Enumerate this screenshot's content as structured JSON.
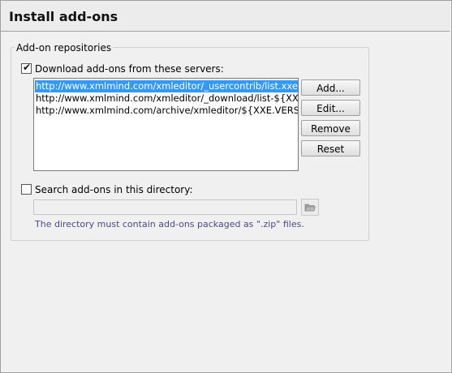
{
  "header": {
    "title": "Install add-ons"
  },
  "repositories": {
    "group_title": "Add-on repositories",
    "download_checkbox": {
      "label": "Download add-ons from these servers:",
      "checked": true
    },
    "servers": [
      "http://www.xmlmind.com/xmleditor/_usercontrib/list.xxe_addon",
      "http://www.xmlmind.com/xmleditor/_download/list-${XXE_VERSI...",
      "http://www.xmlmind.com/archive/xmleditor/${XXE.VERSION}/lis..."
    ],
    "selected_index": 0,
    "buttons": {
      "add": "Add...",
      "edit": "Edit...",
      "remove": "Remove",
      "reset": "Reset"
    },
    "directory_checkbox": {
      "label": "Search add-ons in this directory:",
      "checked": false
    },
    "directory_value": "",
    "hint": "The directory must contain add-ons packaged as \".zip\" files."
  },
  "icons": {
    "folder": "folder-icon",
    "check": "check-icon"
  }
}
